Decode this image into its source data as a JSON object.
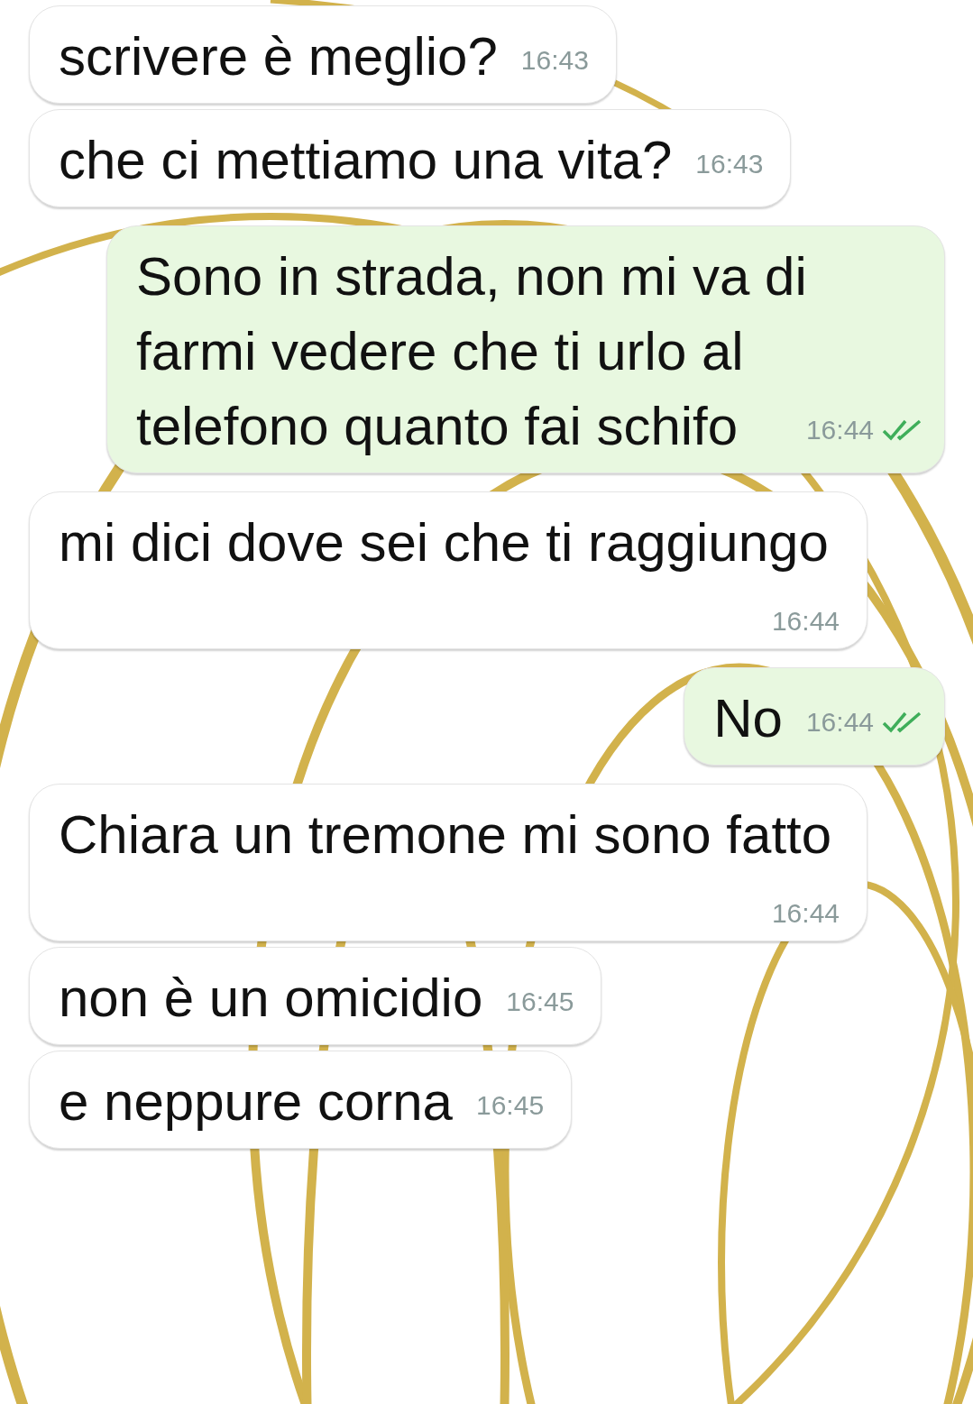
{
  "messages": [
    {
      "kind": "incoming",
      "text": "scrivere è meglio?",
      "time": "16:43"
    },
    {
      "kind": "incoming",
      "text": "che ci mettiamo una vita?",
      "time": "16:43"
    },
    {
      "kind": "outgoing",
      "text": "Sono in strada, non mi va di farmi vedere che ti urlo al telefono quanto fai schifo",
      "time": "16:44",
      "read": true
    },
    {
      "kind": "incoming",
      "text": "mi dici dove sei che ti raggiungo",
      "time": "16:44"
    },
    {
      "kind": "outgoing",
      "text": "No",
      "time": "16:44",
      "read": true
    },
    {
      "kind": "incoming",
      "text": "Chiara un tremone mi sono fatto",
      "time": "16:44"
    },
    {
      "kind": "incoming",
      "text": "non è un omicidio",
      "time": "16:45"
    },
    {
      "kind": "incoming",
      "text": "e neppure corna",
      "time": "16:45"
    }
  ]
}
